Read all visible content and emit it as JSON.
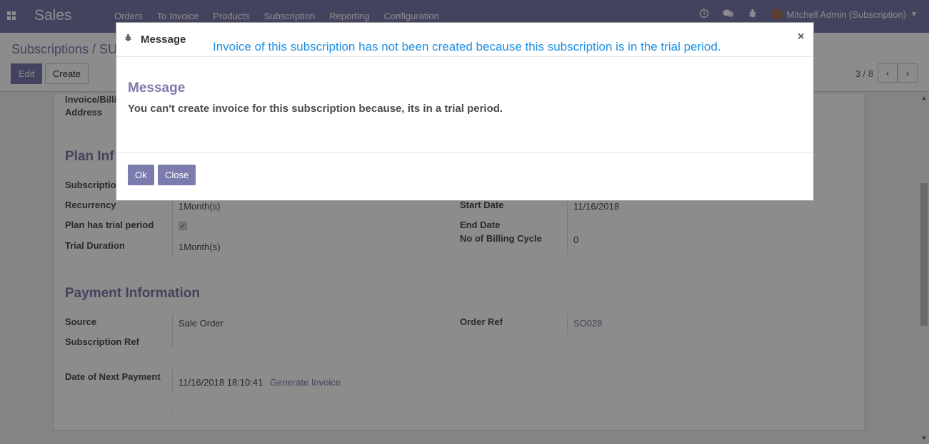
{
  "app": {
    "title": "Sales"
  },
  "menu": [
    "Orders",
    "To Invoice",
    "Products",
    "Subscription",
    "Reporting",
    "Configuration"
  ],
  "user": {
    "name": "Mitchell Admin (Subscription)"
  },
  "breadcrumb": "Subscriptions / SU",
  "toolbar": {
    "edit": "Edit",
    "create": "Create"
  },
  "pager": {
    "text": "3 / 8"
  },
  "form": {
    "invoice_address_label_1": "Invoice/Billi",
    "invoice_address_label_2": "Address",
    "plan_section": "Plan Inf",
    "subscription_label": "Subscriptio",
    "recurrency_label": "Recurrency",
    "recurrency_value": "1Month(s)",
    "trial_label": "Plan has trial period",
    "trial_checked": true,
    "trial_duration_label": "Trial Duration",
    "trial_duration_value": "1Month(s)",
    "start_date_label": "Start Date",
    "start_date_value": "11/16/2018",
    "end_date_label": "End Date",
    "billing_cycle_label": "No of Billing Cycle",
    "billing_cycle_value": "0",
    "payment_section": "Payment Information",
    "source_label": "Source",
    "source_value": "Sale Order",
    "order_ref_label": "Order Ref",
    "order_ref_value": "SO028",
    "subscription_ref_label": "Subscription Ref",
    "next_payment_label": "Date of Next Payment",
    "next_payment_value": "11/16/2018 18:10:41",
    "generate_invoice": "Generate Invoice"
  },
  "modal": {
    "title": "Message",
    "banner": "Invoice of this subscription has not been created because this subscription is in the trial period.",
    "close_glyph": "×",
    "body_title": "Message",
    "body_text": "You can't create invoice for this subscription because, its in a trial period.",
    "ok": "Ok",
    "close": "Close"
  },
  "colors": {
    "brand": "#7c7bad",
    "banner": "#1f8fe3"
  }
}
